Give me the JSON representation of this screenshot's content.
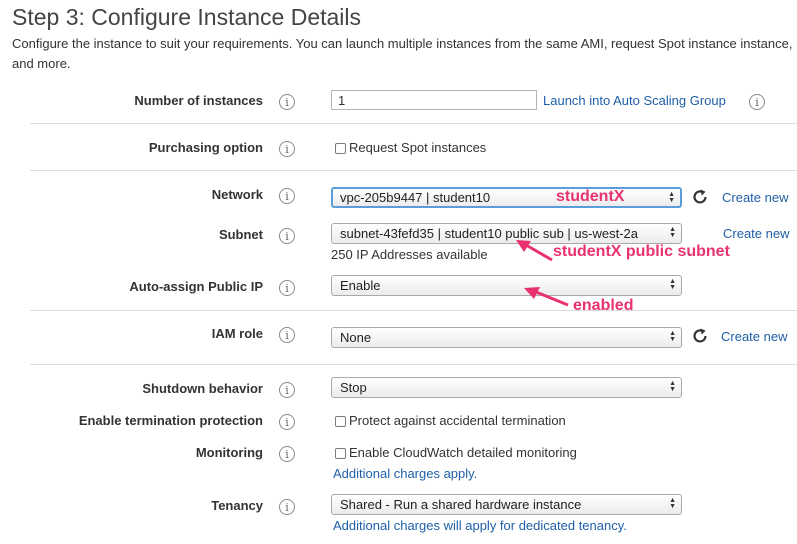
{
  "header": {
    "title": "Step 3: Configure Instance Details",
    "description": "Configure the instance to suit your requirements. You can launch multiple instances from the same AMI, request Spot instance instance, and more."
  },
  "fields": {
    "instances": {
      "label": "Number of instances",
      "value": "1",
      "link": "Launch into Auto Scaling Group"
    },
    "purchasing": {
      "label": "Purchasing option",
      "checkbox_label": "Request Spot instances"
    },
    "network": {
      "label": "Network",
      "value": "vpc-205b9447 | student10",
      "create_link": "Create new"
    },
    "subnet": {
      "label": "Subnet",
      "value": "subnet-43fefd35 | student10 public sub | us-west-2a",
      "available": "250 IP Addresses available",
      "create_link": "Create new"
    },
    "public_ip": {
      "label": "Auto-assign Public IP",
      "value": "Enable"
    },
    "iam_role": {
      "label": "IAM role",
      "value": "None",
      "create_link": "Create new"
    },
    "shutdown": {
      "label": "Shutdown behavior",
      "value": "Stop"
    },
    "termination": {
      "label": "Enable termination protection",
      "checkbox_label": "Protect against accidental termination"
    },
    "monitoring": {
      "label": "Monitoring",
      "checkbox_label": "Enable CloudWatch detailed monitoring",
      "note": "Additional charges apply."
    },
    "tenancy": {
      "label": "Tenancy",
      "value": "Shared - Run a shared hardware instance",
      "note": "Additional charges will apply for dedicated tenancy."
    }
  },
  "annotations": {
    "network": "studentX",
    "subnet": "studentX public subnet",
    "public_ip": "enabled"
  },
  "icons": {
    "info": "i",
    "refresh": "refresh-icon"
  },
  "colors": {
    "link": "#1f5fa8",
    "annotation": "#e8336e",
    "focus_border": "#5b9ddb"
  }
}
